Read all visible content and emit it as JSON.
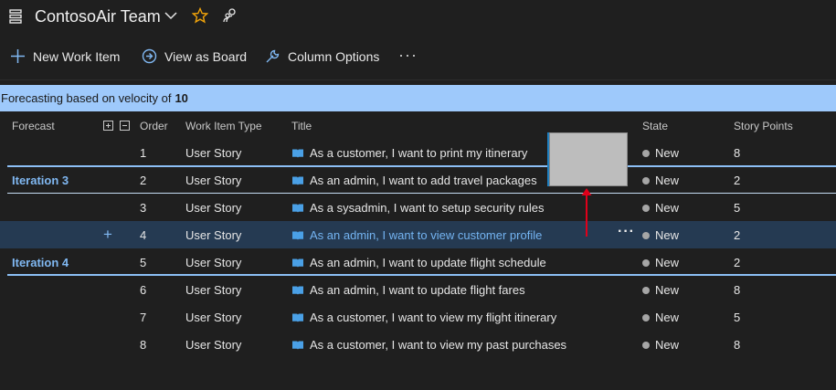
{
  "header": {
    "team_name": "ContosoAir Team"
  },
  "toolbar": {
    "new_work_item": "New Work Item",
    "view_as_board": "View as Board",
    "column_options": "Column Options",
    "more": "···"
  },
  "banner": {
    "text": "Forecasting based on velocity of",
    "velocity": "10"
  },
  "columns": {
    "forecast": "Forecast",
    "order": "Order",
    "type": "Work Item Type",
    "title": "Title",
    "state": "State",
    "points": "Story Points"
  },
  "rows": [
    {
      "iteration": "",
      "order": "1",
      "type": "User Story",
      "title": "As a customer, I want to print my itinerary",
      "state": "New",
      "points": "8"
    },
    {
      "iteration": "Iteration 3",
      "order": "2",
      "type": "User Story",
      "title": "As an admin, I want to add travel packages",
      "state": "New",
      "points": "2"
    },
    {
      "iteration": "",
      "order": "3",
      "type": "User Story",
      "title": "As a sysadmin, I want to setup security rules",
      "state": "New",
      "points": "5"
    },
    {
      "iteration": "",
      "order": "4",
      "type": "User Story",
      "title": "As an admin, I want to view customer profile",
      "state": "New",
      "points": "2",
      "selected": true
    },
    {
      "iteration": "Iteration 4",
      "order": "5",
      "type": "User Story",
      "title": "As an admin, I want to update flight schedule",
      "state": "New",
      "points": "2"
    },
    {
      "iteration": "",
      "order": "6",
      "type": "User Story",
      "title": "As an admin, I want to update flight fares",
      "state": "New",
      "points": "8"
    },
    {
      "iteration": "",
      "order": "7",
      "type": "User Story",
      "title": "As a customer, I want to view my flight itinerary",
      "state": "New",
      "points": "5"
    },
    {
      "iteration": "",
      "order": "8",
      "type": "User Story",
      "title": "As a customer, I want to view my past purchases",
      "state": "New",
      "points": "8"
    }
  ],
  "icons": {
    "team": "backlog-icon",
    "chevron": "chevron-down-icon",
    "favorite": "star-icon",
    "members": "team-members-icon",
    "add": "plus-icon",
    "board": "arrow-circle-icon",
    "columns": "wrench-icon",
    "story": "book-icon"
  },
  "colors": {
    "accent": "#80b8f2",
    "banner": "#9ec9fb",
    "favorite": "#f0a30a",
    "drag_arrow": "#e0001a"
  }
}
